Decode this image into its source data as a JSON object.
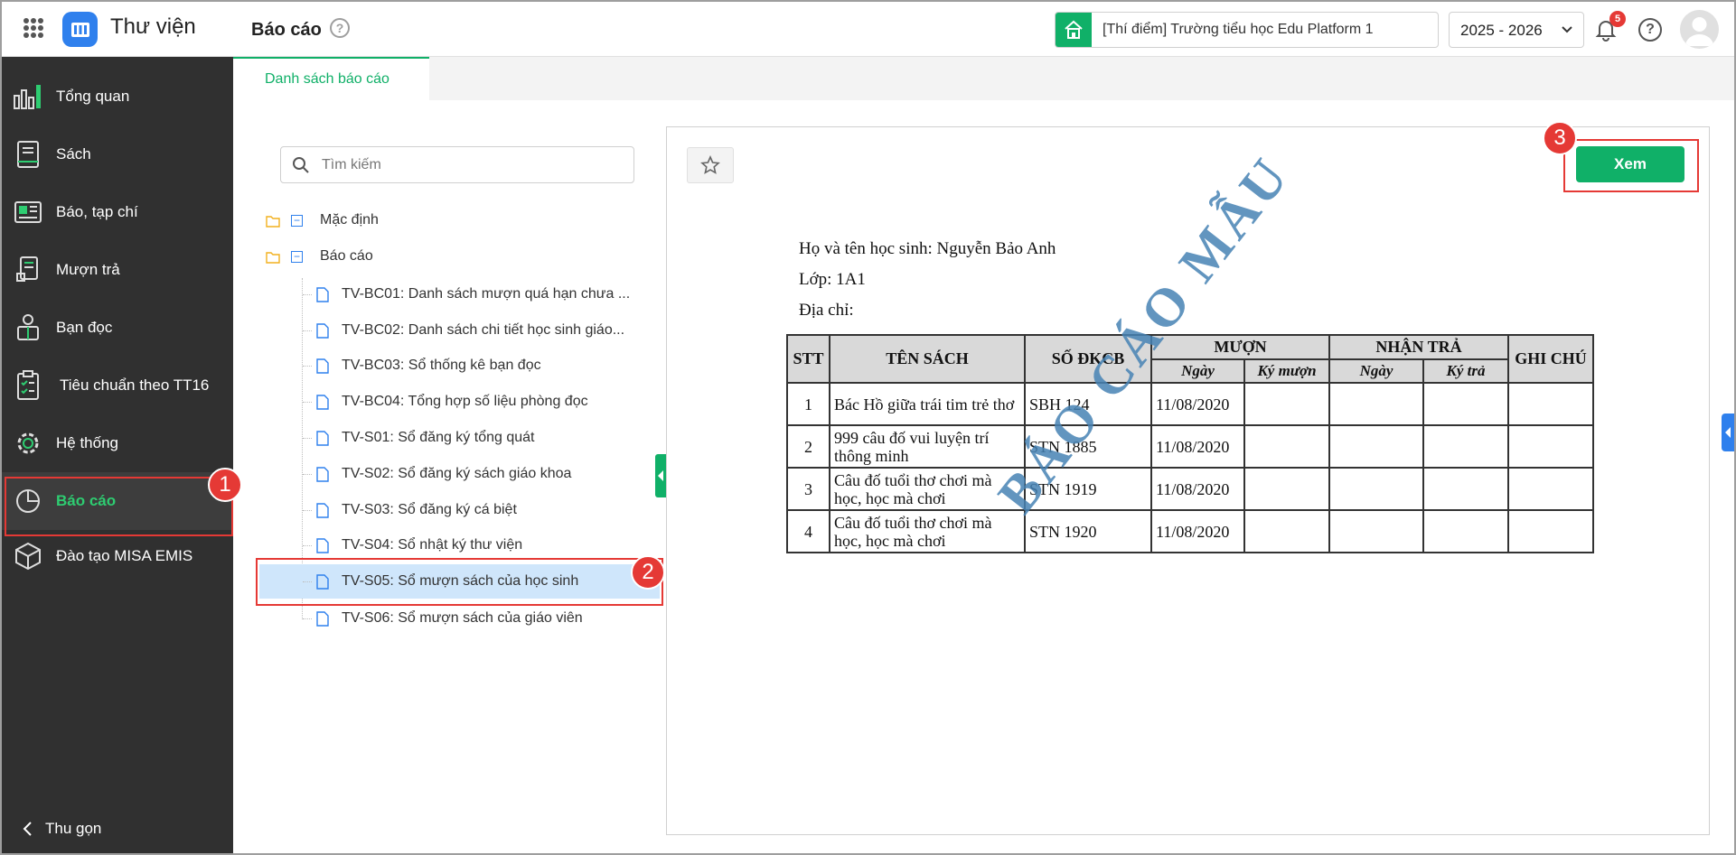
{
  "header": {
    "app_title": "Thư viện",
    "page_title": "Báo cáo",
    "school": "[Thí điểm] Trường tiểu học Edu Platform 1",
    "school_year": "2025 - 2026",
    "notification_count": "5"
  },
  "sidebar": {
    "items": [
      {
        "label": "Tổng quan",
        "icon": "chart-bars-icon"
      },
      {
        "label": "Sách",
        "icon": "book-icon"
      },
      {
        "label": "Báo, tạp chí",
        "icon": "newspaper-icon"
      },
      {
        "label": "Mượn trả",
        "icon": "borrow-return-icon"
      },
      {
        "label": "Bạn đọc",
        "icon": "reader-icon"
      },
      {
        "label": "Tiêu chuẩn theo TT16",
        "icon": "checklist-icon"
      },
      {
        "label": "Hệ thống",
        "icon": "gear-icon"
      },
      {
        "label": "Báo cáo",
        "icon": "pie-chart-icon"
      },
      {
        "label": "Đào tạo MISA EMIS",
        "icon": "cube-icon"
      }
    ],
    "active": "Báo cáo",
    "collapse_label": "Thu gọn"
  },
  "tabs": {
    "active_label": "Danh sách báo cáo"
  },
  "tree": {
    "search_placeholder": "Tìm kiếm",
    "folders": [
      "Mặc định",
      "Báo cáo"
    ],
    "items": [
      "TV-BC01: Danh sách mượn quá hạn chưa ...",
      "TV-BC02: Danh sách chi tiết học sinh giáo...",
      "TV-BC03: Sổ thống kê bạn đọc",
      "TV-BC04: Tổng hợp số liệu phòng đọc",
      "TV-S01: Sổ đăng ký tổng quát",
      "TV-S02: Sổ đăng ký sách giáo khoa",
      "TV-S03: Sổ đăng ký cá biệt",
      "TV-S04: Sổ nhật ký thư viện",
      "TV-S05: Sổ mượn sách của học sinh",
      "TV-S06: Sổ mượn sách của giáo viên"
    ],
    "selected": "TV-S05: Sổ mượn sách của học sinh"
  },
  "preview": {
    "view_button": "Xem",
    "student_line": "Họ và tên học sinh:  Nguyễn Bảo Anh",
    "class_line": "Lớp:  1A1",
    "address_line": "Địa chỉ:",
    "watermark": "BÁO CÁO MẪU",
    "table": {
      "headers": {
        "stt": "STT",
        "book": "TÊN SÁCH",
        "reg": "SỐ ĐKCB",
        "borrow": "MƯỢN",
        "return": "NHẬN TRẢ",
        "note": "GHI CHÚ",
        "borrow_date": "Ngày",
        "borrow_sign": "Ký mượn",
        "return_date": "Ngày",
        "return_sign": "Ký trả"
      },
      "rows": [
        {
          "stt": "1",
          "book": "Bác Hồ giữa trái tim trẻ thơ",
          "reg": "SBH 124",
          "date": "11/08/2020"
        },
        {
          "stt": "2",
          "book": "999 câu đố vui luyện trí thông minh",
          "reg": "STN 1885",
          "date": "11/08/2020"
        },
        {
          "stt": "3",
          "book": "Câu đố tuổi thơ chơi mà học, học mà chơi",
          "reg": "STN 1919",
          "date": "11/08/2020"
        },
        {
          "stt": "4",
          "book": "Câu đố tuổi thơ chơi mà học, học mà chơi",
          "reg": "STN 1920",
          "date": "11/08/2020"
        }
      ]
    }
  },
  "callouts": [
    "1",
    "2",
    "3"
  ],
  "colors": {
    "accent": "#10b068",
    "sidebar_bg": "#303030",
    "selection": "#cfe6fb",
    "callout": "#e53935",
    "logo": "#2f80ed"
  }
}
